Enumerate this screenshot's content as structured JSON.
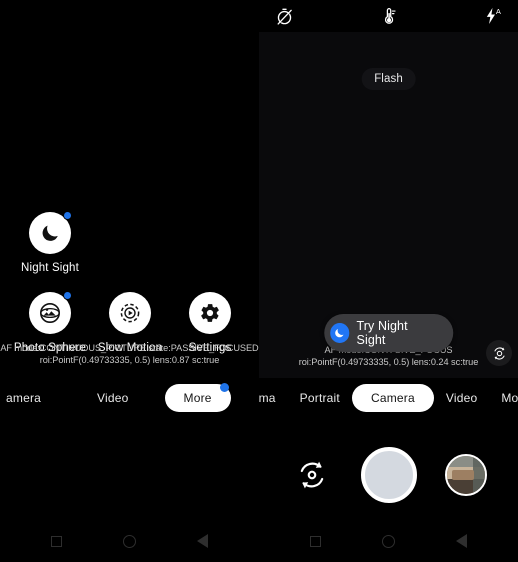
{
  "left_panel": {
    "debug_line1": "AF mode:CONTINUOUS_PICTURE state:PASSIVE_FOCUSED",
    "debug_line2": "roi:PointF(0.49733335, 0.5) lens:0.87 sc:true",
    "modes": [
      {
        "label": "Night Sight",
        "icon": "moon-icon",
        "badge": true
      },
      {
        "label": "Photo Sphere",
        "icon": "photo-sphere-icon",
        "badge": true
      },
      {
        "label": "Slow Motion",
        "icon": "slow-motion-icon",
        "badge": false
      },
      {
        "label": "Settings",
        "icon": "gear-icon",
        "badge": false
      }
    ],
    "mode_tabs": [
      {
        "label": "amera",
        "selected": false,
        "badge": false
      },
      {
        "label": "Video",
        "selected": false,
        "badge": false
      },
      {
        "label": "More",
        "selected": true,
        "badge": true
      }
    ]
  },
  "right_panel": {
    "status_icons": [
      {
        "name": "timer-off-icon"
      },
      {
        "name": "white-balance-icon"
      },
      {
        "name": "flash-auto-icon",
        "label": "A"
      }
    ],
    "toast": "Flash",
    "night_sight_pill": {
      "label": "Try Night Sight",
      "icon": "moon-icon",
      "badge_color": "#2176f5"
    },
    "debug_line1": "AF mode:CONTI                      SIVE_FOCUS",
    "debug_line2": "roi:PointF(0.49733335, 0.5) lens:0.24 sc:true",
    "corner_button": "camera-flip-icon",
    "mode_tabs": [
      {
        "label": "rama",
        "selected": false
      },
      {
        "label": "Portrait",
        "selected": false
      },
      {
        "label": "Camera",
        "selected": true
      },
      {
        "label": "Video",
        "selected": false
      },
      {
        "label": "More",
        "selected": false
      }
    ],
    "shutter_controls": {
      "flip": "camera-flip-icon",
      "shutter": "shutter-button",
      "thumbnail": "gallery-thumbnail"
    }
  },
  "navbar": {
    "buttons": [
      {
        "name": "recents-button",
        "icon": "square-icon"
      },
      {
        "name": "home-button",
        "icon": "circle-icon"
      },
      {
        "name": "back-button",
        "icon": "triangle-icon"
      }
    ]
  },
  "colors": {
    "accent_blue": "#1f73e8",
    "pill_bg": "#3b3b3e",
    "selected_tab_bg": "#ffffff",
    "background": "#000000"
  }
}
